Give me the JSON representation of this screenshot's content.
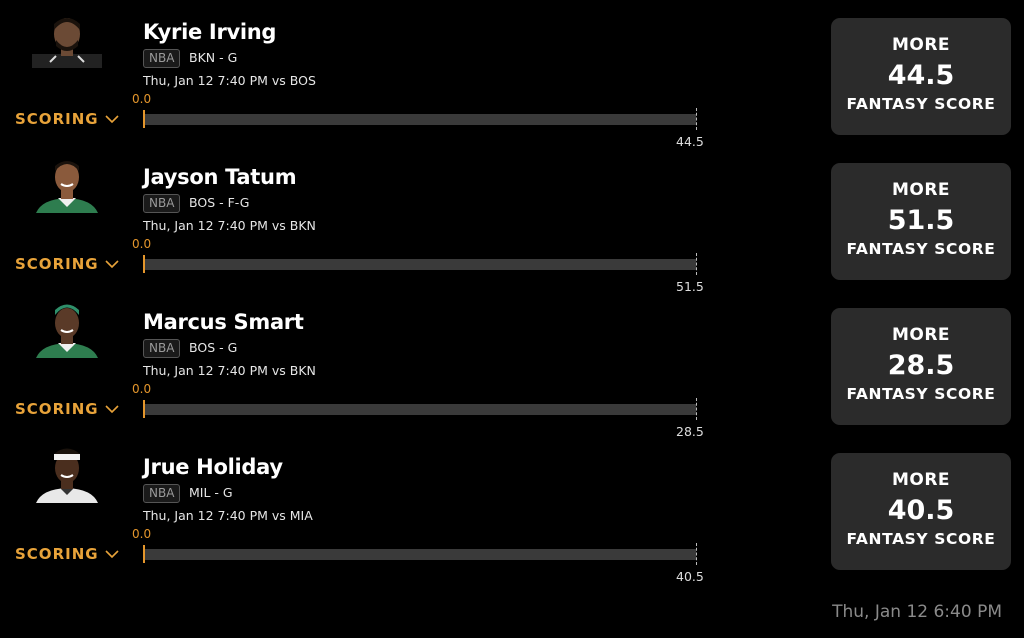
{
  "projections": [
    {
      "player_name": "Kyrie Irving",
      "league": "NBA",
      "team_position": "BKN - G",
      "game_info": "Thu, Jan 12 7:40 PM  vs BOS",
      "range_min": "0.0",
      "range_max": "44.5",
      "scoring_label": "SCORING",
      "card_direction": "MORE",
      "card_line": "44.5",
      "card_stat": "FANTASY SCORE",
      "jersey_color": "#222222"
    },
    {
      "player_name": "Jayson Tatum",
      "league": "NBA",
      "team_position": "BOS - F-G",
      "game_info": "Thu, Jan 12 7:40 PM  vs BKN",
      "range_min": "0.0",
      "range_max": "51.5",
      "scoring_label": "SCORING",
      "card_direction": "MORE",
      "card_line": "51.5",
      "card_stat": "FANTASY SCORE",
      "jersey_color": "#2e7d4f"
    },
    {
      "player_name": "Marcus Smart",
      "league": "NBA",
      "team_position": "BOS - G",
      "game_info": "Thu, Jan 12 7:40 PM  vs BKN",
      "range_min": "0.0",
      "range_max": "28.5",
      "scoring_label": "SCORING",
      "card_direction": "MORE",
      "card_line": "28.5",
      "card_stat": "FANTASY SCORE",
      "jersey_color": "#2e7d4f"
    },
    {
      "player_name": "Jrue Holiday",
      "league": "NBA",
      "team_position": "MIL - G",
      "game_info": "Thu, Jan 12 7:40 PM  vs MIA",
      "range_min": "0.0",
      "range_max": "40.5",
      "scoring_label": "SCORING",
      "card_direction": "MORE",
      "card_line": "40.5",
      "card_stat": "FANTASY SCORE",
      "jersey_color": "#e8e8e8"
    }
  ],
  "footer": {
    "timestamp": "Thu, Jan 12 6:40 PM"
  },
  "colors": {
    "accent": "#e8a33a",
    "card_bg": "#2b2b2b",
    "track_bg": "#3a3a3a",
    "page_bg": "#000000"
  }
}
